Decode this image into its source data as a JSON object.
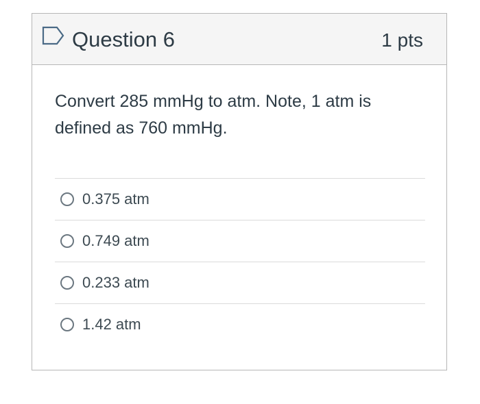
{
  "question": {
    "title": "Question 6",
    "points": "1 pts",
    "text_line1": "Convert 285 mmHg to atm. Note, 1 atm is",
    "text_line2": "defined as 760 mmHg.",
    "flag_icon": "flag-outline-icon"
  },
  "answers": [
    {
      "label": "0.375 atm",
      "selected": false
    },
    {
      "label": "0.749 atm",
      "selected": false
    },
    {
      "label": "0.233 atm",
      "selected": false
    },
    {
      "label": "1.42 atm",
      "selected": false
    }
  ],
  "colors": {
    "header_bg": "#f5f5f5",
    "border": "#b6b6b6",
    "text": "#2d3b45",
    "flag": "#2d3b45"
  }
}
